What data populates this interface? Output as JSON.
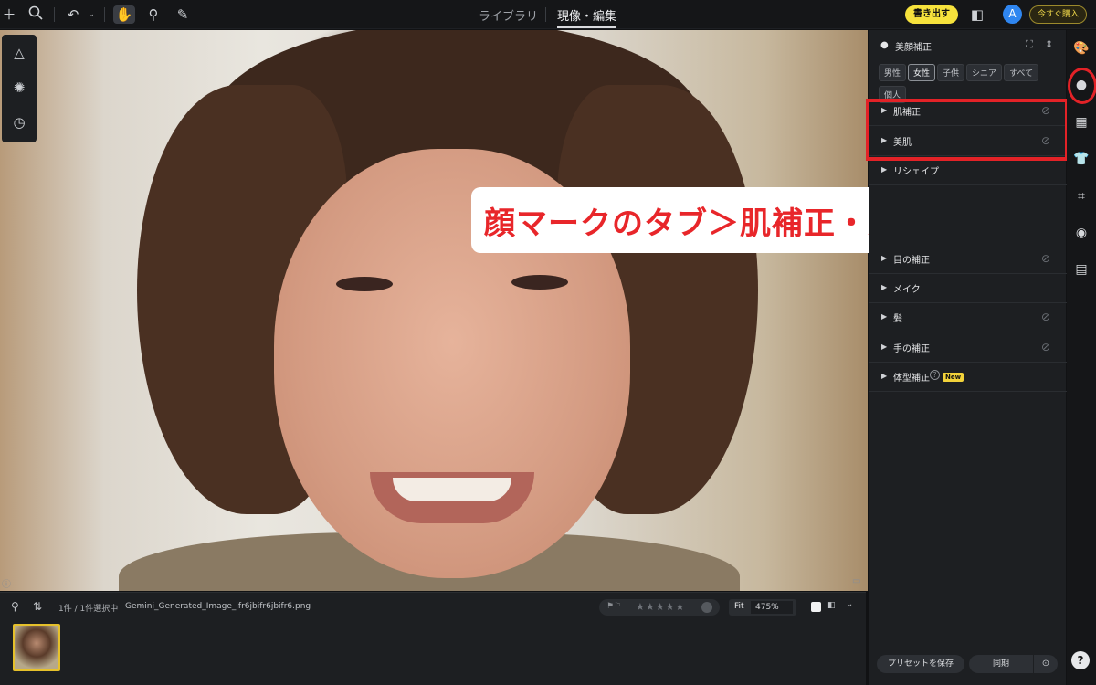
{
  "topbar": {
    "tabs": [
      "ライブラリ",
      "現像・編集"
    ],
    "active_tab": "現像・編集",
    "export_label": "書き出す",
    "avatar_letter": "A",
    "buy_label": "今すぐ購入",
    "icons": [
      "plus-icon",
      "search-icon",
      "undo-icon",
      "chevron-down-icon",
      "hand-icon",
      "stamp-icon",
      "brush-icon",
      "compare-icon"
    ]
  },
  "left_tools": {
    "icons": [
      "triangle-adjust-icon",
      "sun-icon",
      "history-icon"
    ]
  },
  "callout": {
    "text": "顔マークのタブ＞肌補正・美肌"
  },
  "right_panel": {
    "title": "美顔補正",
    "chips": [
      "男性",
      "女性",
      "子供",
      "シニア",
      "すべて",
      "個人"
    ],
    "active_chip": "女性",
    "sections": [
      {
        "label": "肌補正",
        "has_sub": true
      },
      {
        "label": "美肌",
        "has_sub": true
      },
      {
        "label": "リシェイプ",
        "has_sub": false
      },
      {
        "label": "目の補正",
        "has_sub": true
      },
      {
        "label": "メイク",
        "has_sub": false
      },
      {
        "label": "髪",
        "has_sub": true
      },
      {
        "label": "手の補正",
        "has_sub": true
      },
      {
        "label": "体型補正",
        "has_sub": false,
        "badge": "New"
      }
    ],
    "footer": {
      "save_preset": "プリセットを保存",
      "sync": "同期"
    }
  },
  "rail": {
    "icons": [
      "palette-icon",
      "face-icon",
      "grid-icon",
      "shirt-icon",
      "crop-icon",
      "camera-icon",
      "folder-icon"
    ],
    "help": "?"
  },
  "filmstrip": {
    "count_text": "1件 / 1件選択中",
    "filename": "Gemini_Generated_Image_ifr6jbifr6jbifr6.png",
    "rating_stars": "★★★★★",
    "zoom_fit": "Fit",
    "zoom_value": "475%"
  },
  "colors": {
    "accent_yellow": "#f6e23c",
    "highlight_red": "#e32227",
    "avatar_blue": "#2f86f0"
  }
}
